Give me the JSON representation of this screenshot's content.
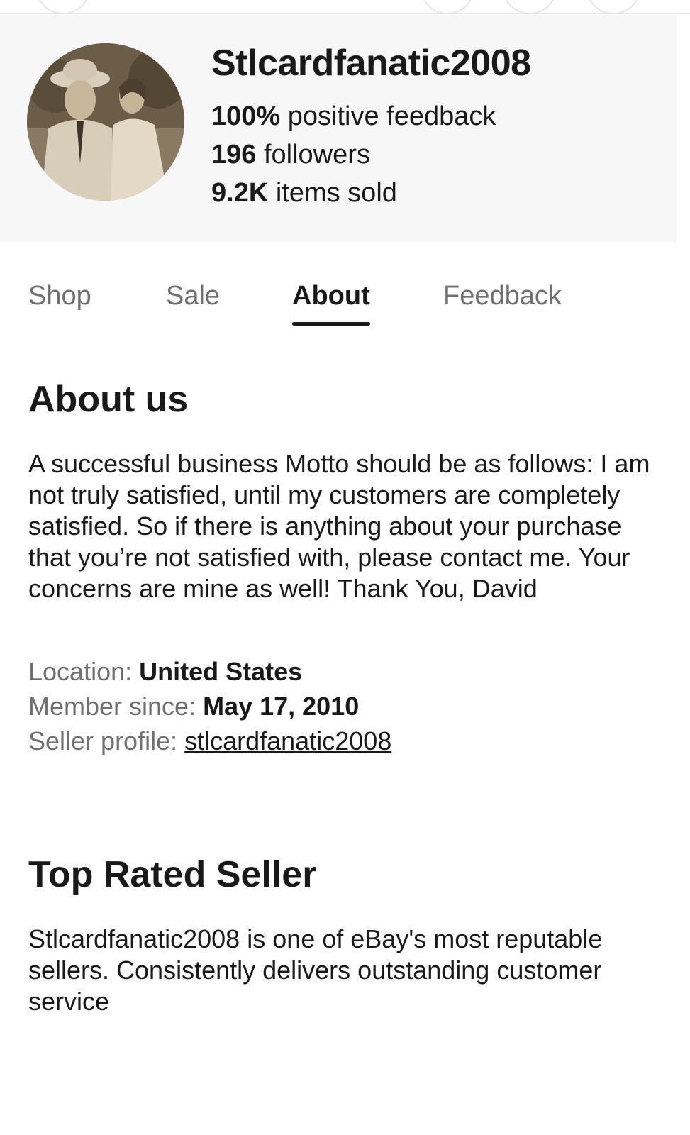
{
  "seller": {
    "name": "Stlcardfanatic2008",
    "feedback_value": "100%",
    "feedback_label": " positive feedback",
    "followers_value": "196",
    "followers_label": " followers",
    "sold_value": "9.2K",
    "sold_label": " items sold"
  },
  "tabs": [
    {
      "label": "Shop"
    },
    {
      "label": "Sale"
    },
    {
      "label": "About",
      "active": true
    },
    {
      "label": "Feedback"
    }
  ],
  "about": {
    "heading": "About us",
    "text": "A successful business Motto should be as follows: I am not truly satisfied, until my customers are completely satisfied. So if there is anything about your purchase that you’re not satisfied with, please contact me. Your concerns are mine as well! Thank You, David",
    "location_label": "Location: ",
    "location_value": "United States",
    "member_label": "Member since: ",
    "member_value": "May 17, 2010",
    "profile_label": "Seller profile: ",
    "profile_value": "stlcardfanatic2008"
  },
  "top_rated": {
    "heading": "Top Rated Seller",
    "text": "Stlcardfanatic2008 is one of eBay's most reputable sellers. Consistently delivers outstanding customer service"
  },
  "colors": {
    "header_bg": "#f7f7f7",
    "text_primary": "#191919",
    "text_secondary": "#707070"
  }
}
